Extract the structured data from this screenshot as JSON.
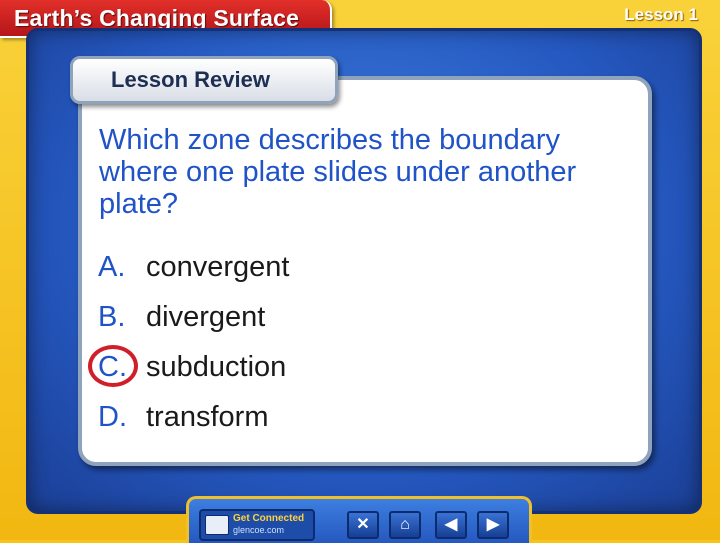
{
  "header": {
    "title": "Earth’s Changing Surface",
    "lesson": "Lesson 1"
  },
  "card": {
    "tab_label": "Lesson Review",
    "question": "Which zone describes the boundary where one plate slides under another plate?",
    "answers": [
      {
        "letter": "A.",
        "text": "convergent",
        "selected": false
      },
      {
        "letter": "B.",
        "text": "divergent",
        "selected": false
      },
      {
        "letter": "C.",
        "text": "subduction",
        "selected": true
      },
      {
        "letter": "D.",
        "text": "transform",
        "selected": false
      }
    ]
  },
  "toolbar": {
    "get_connected_title": "Get Connected",
    "get_connected_url": "glencoe.com",
    "buttons": [
      {
        "icon": "close-icon",
        "glyph": "✕"
      },
      {
        "icon": "home-icon",
        "glyph": "⌂"
      },
      {
        "icon": "previous-icon",
        "glyph": "◀"
      },
      {
        "icon": "next-icon",
        "glyph": "▶"
      }
    ]
  },
  "colors": {
    "accent_blue": "#1f53c7",
    "highlight_red": "#d11f2a",
    "banner_red": "#c41e22",
    "frame_yellow": "#f7c51a"
  }
}
